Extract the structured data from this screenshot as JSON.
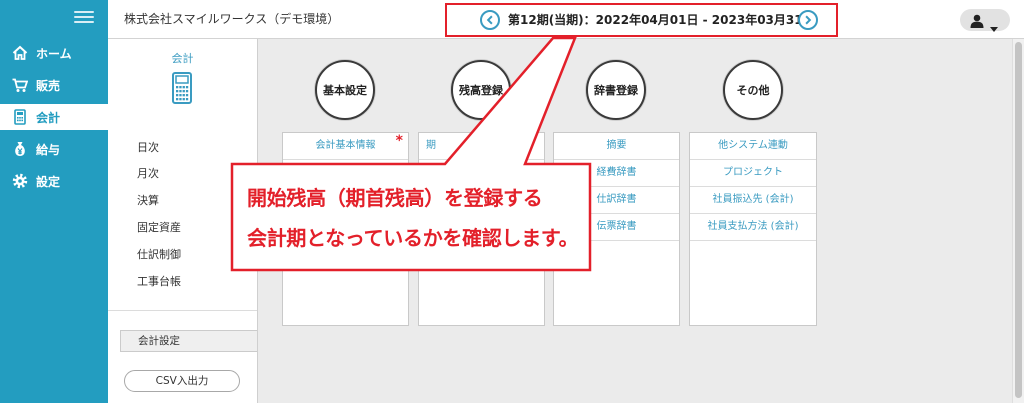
{
  "sidebar": {
    "menu_icon": "hamburger-icon",
    "items": [
      {
        "label": "ホーム",
        "icon": "home-icon",
        "active": false
      },
      {
        "label": "販売",
        "icon": "cart-icon",
        "active": false
      },
      {
        "label": "会計",
        "icon": "calculator-icon",
        "active": true
      },
      {
        "label": "給与",
        "icon": "money-bag-icon",
        "active": false
      },
      {
        "label": "設定",
        "icon": "gear-icon",
        "active": false
      }
    ]
  },
  "header": {
    "company": "株式会社スマイルワークス（デモ環境）",
    "period": "第12期(当期)：2022年04月01日 - 2023年03月31日",
    "prev_icon": "chevron-left-icon",
    "next_icon": "chevron-right-icon",
    "user_icon": "user-icon",
    "user_caret_icon": "caret-down-icon"
  },
  "subnav": {
    "title": "会計",
    "icon": "calculator-icon",
    "items": [
      "日次",
      "月次",
      "決算",
      "固定資産",
      "仕訳制御",
      "工事台帳"
    ],
    "settings_tab": "会計設定",
    "csv_button": "CSV入出力"
  },
  "categories": [
    {
      "title": "基本設定",
      "items": [
        {
          "label": "会計基本情報",
          "mark": "*"
        }
      ]
    },
    {
      "title": "残高登録",
      "items": [
        {
          "label": "期"
        }
      ]
    },
    {
      "title": "辞書登録",
      "items": [
        {
          "label": "摘要"
        },
        {
          "label": "経費辞書"
        },
        {
          "label": "仕訳辞書"
        },
        {
          "label": "伝票辞書"
        }
      ]
    },
    {
      "title": "その他",
      "items": [
        {
          "label": "他システム連動"
        },
        {
          "label": "プロジェクト"
        },
        {
          "label": "社員振込先 (会計)"
        },
        {
          "label": "社員支払方法 (会計)"
        }
      ]
    }
  ],
  "callout": {
    "lines": [
      "開始残高（期首残高）を登録する",
      "会計期となっているかを確認します。"
    ]
  },
  "colors": {
    "sidebar": "#239dc0",
    "accent": "#3a9bc1",
    "highlight_red": "#e3202a"
  }
}
